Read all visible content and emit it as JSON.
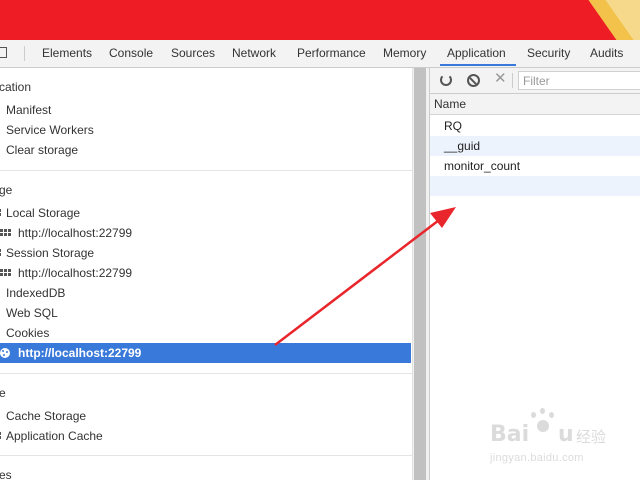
{
  "tabs": [
    {
      "label": "Elements",
      "active": false
    },
    {
      "label": "Console",
      "active": false
    },
    {
      "label": "Sources",
      "active": false
    },
    {
      "label": "Network",
      "active": false
    },
    {
      "label": "Performance",
      "active": false
    },
    {
      "label": "Memory",
      "active": false
    },
    {
      "label": "Application",
      "active": true
    },
    {
      "label": "Security",
      "active": false
    },
    {
      "label": "Audits",
      "active": false
    }
  ],
  "sidebar": {
    "application_header": "cation",
    "application_items": [
      "Manifest",
      "Service Workers",
      "Clear storage"
    ],
    "storage_header": "ge",
    "local_storage": {
      "label": "Local Storage",
      "origin": "http://localhost:22799"
    },
    "session_storage": {
      "label": "Session Storage",
      "origin": "http://localhost:22799"
    },
    "indexeddb": "IndexedDB",
    "web_sql": "Web SQL",
    "cookies": {
      "label": "Cookies",
      "origin": "http://localhost:22799",
      "selected": true
    },
    "cache_header": "e",
    "cache_items": [
      "Cache Storage",
      "Application Cache"
    ],
    "frames_header": "es"
  },
  "cookie_pane": {
    "filter_placeholder": "Filter",
    "column_name": "Name",
    "rows": [
      "RQ",
      "__guid",
      "monitor_count"
    ]
  },
  "colors": {
    "accent": "#3879d9",
    "top_bar": "#ee1c25",
    "annotation_arrow": "#e8262c"
  },
  "icons": {
    "toolbar": [
      "refresh-icon",
      "block-icon",
      "clear-icon"
    ],
    "tree": [
      "grid-icon",
      "cookie-icon",
      "dock-icon"
    ]
  },
  "watermark": {
    "brand": "Bai",
    "brand_tail": "u",
    "cn": "经验",
    "url": "jingyan.baidu.com"
  }
}
